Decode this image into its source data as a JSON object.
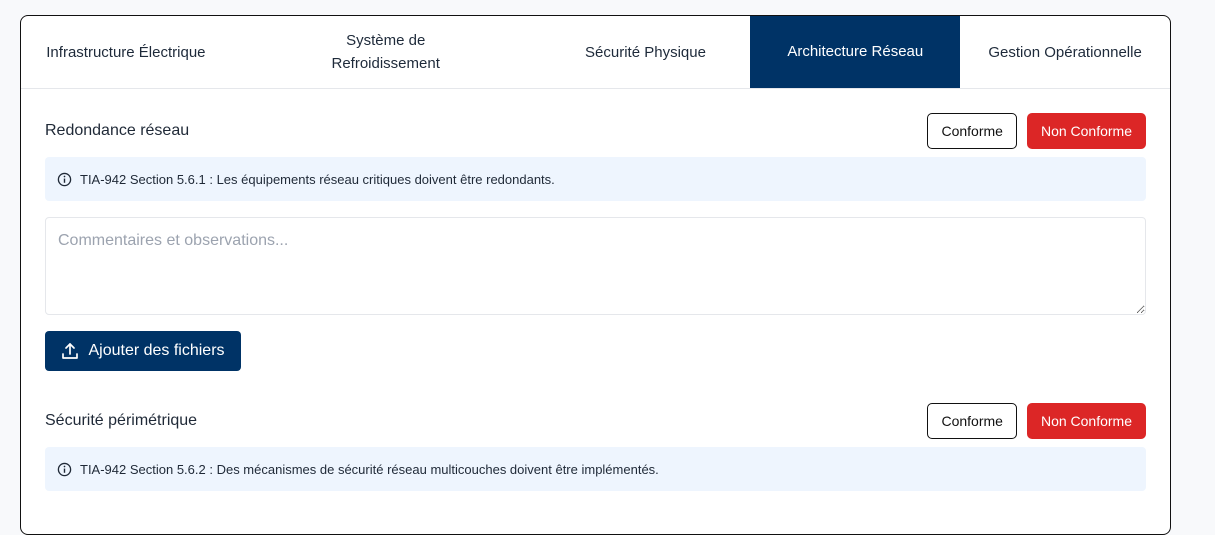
{
  "tabs": [
    {
      "label": "Infrastructure Électrique",
      "active": false
    },
    {
      "label": "Système de Refroidissement",
      "active": false
    },
    {
      "label": "Sécurité Physique",
      "active": false
    },
    {
      "label": "Architecture Réseau",
      "active": true
    },
    {
      "label": "Gestion Opérationnelle",
      "active": false
    }
  ],
  "sections": [
    {
      "title": "Redondance réseau",
      "conforme_label": "Conforme",
      "non_conforme_label": "Non Conforme",
      "info": "TIA-942 Section 5.6.1 : Les équipements réseau critiques doivent être redondants.",
      "comment_placeholder": "Commentaires et observations...",
      "comment_value": "",
      "upload_label": "Ajouter des fichiers"
    },
    {
      "title": "Sécurité périmétrique",
      "conforme_label": "Conforme",
      "non_conforme_label": "Non Conforme",
      "info": "TIA-942 Section 5.6.2 : Des mécanismes de sécurité réseau multicouches doivent être implémentés."
    }
  ],
  "colors": {
    "primary": "#003366",
    "danger": "#dc2626",
    "info_bg": "#eef5fe"
  },
  "icons": {
    "info": "info-circle-icon",
    "upload": "upload-icon"
  }
}
